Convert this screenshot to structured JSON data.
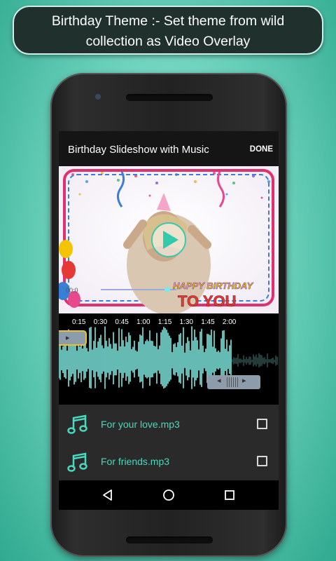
{
  "banner": {
    "line1": "Birthday Theme :-  Set theme from wild",
    "line2": "collection as Video Overlay"
  },
  "app": {
    "title": "Birthday Slideshow with Music",
    "done_label": "DONE"
  },
  "video": {
    "overlay_text_1": "HAPPY BIRTHDAY",
    "overlay_text_2": "TO YOU",
    "time_label": "00:0",
    "progress": 0.45
  },
  "timeline": {
    "ticks": [
      "0:15",
      "0:30",
      "0:45",
      "1:00",
      "1:15",
      "1:30",
      "1:45",
      "2:00"
    ]
  },
  "music_list": [
    {
      "name": "For your love.mp3",
      "checked": false
    },
    {
      "name": "For friends.mp3",
      "checked": false
    }
  ],
  "colors": {
    "accent": "#4ad7bd",
    "waveform": "#7fe8e2",
    "handle_yellow": "#e8c32a"
  },
  "icons": {
    "music": "music-note-icon",
    "back": "nav-back-icon",
    "home": "nav-home-icon",
    "recents": "nav-recents-icon"
  }
}
